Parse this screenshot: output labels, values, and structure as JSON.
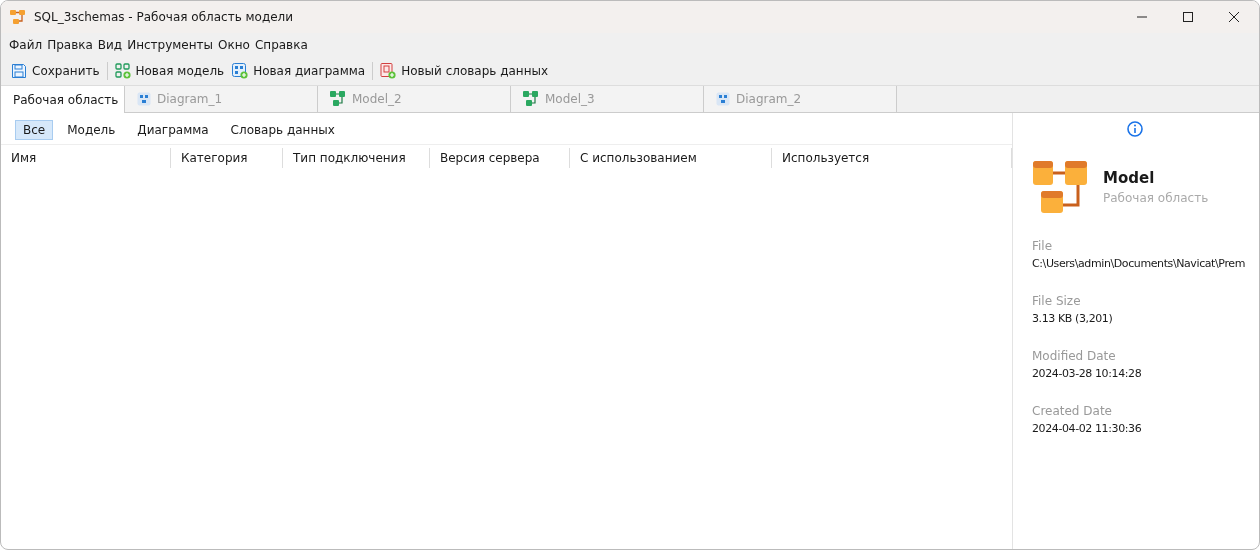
{
  "window": {
    "title": "SQL_3schemas - Рабочая область модели"
  },
  "menu": [
    "Файл",
    "Правка",
    "Вид",
    "Инструменты",
    "Окно",
    "Справка"
  ],
  "toolbar": [
    {
      "kind": "save",
      "label": "Сохранить"
    },
    {
      "kind": "model",
      "label": "Новая модель"
    },
    {
      "kind": "diagram",
      "label": "Новая диаграмма"
    },
    {
      "kind": "dictionary",
      "label": "Новый словарь данных"
    }
  ],
  "tabs": [
    {
      "kind": "workspace",
      "label": "Рабочая область",
      "selected": true
    },
    {
      "kind": "diagram",
      "label": "Diagram_1",
      "selected": false
    },
    {
      "kind": "model",
      "label": "Model_2",
      "selected": false
    },
    {
      "kind": "model",
      "label": "Model_3",
      "selected": false
    },
    {
      "kind": "diagram",
      "label": "Diagram_2",
      "selected": false
    }
  ],
  "filters": [
    {
      "label": "Все",
      "selected": true
    },
    {
      "label": "Модель",
      "selected": false
    },
    {
      "label": "Диаграмма",
      "selected": false
    },
    {
      "label": "Словарь данных",
      "selected": false
    }
  ],
  "table": {
    "columns": [
      "Имя",
      "Категория",
      "Тип подключения",
      "Версия сервера",
      "С использованием",
      "Используется"
    ]
  },
  "details": {
    "name": "Model",
    "type": "Рабочая область",
    "fields": [
      {
        "label": "File",
        "value": "C:\\Users\\admin\\Documents\\Navicat\\Prem"
      },
      {
        "label": "File Size",
        "value": "3.13 KB (3,201)"
      },
      {
        "label": "Modified Date",
        "value": "2024-03-28 10:14:28"
      },
      {
        "label": "Created Date",
        "value": "2024-04-02 11:30:36"
      }
    ]
  }
}
